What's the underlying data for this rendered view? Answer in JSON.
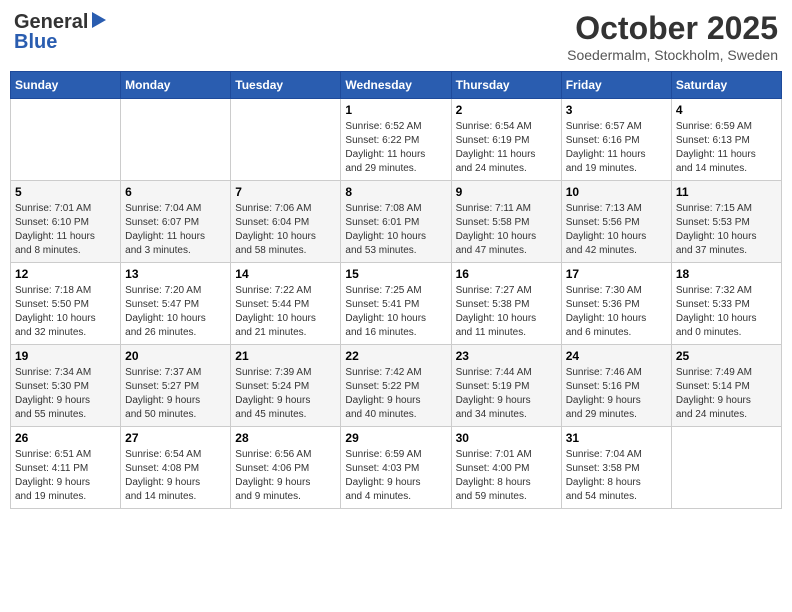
{
  "header": {
    "logo_general": "General",
    "logo_blue": "Blue",
    "month": "October 2025",
    "location": "Soedermalm, Stockholm, Sweden"
  },
  "days_of_week": [
    "Sunday",
    "Monday",
    "Tuesday",
    "Wednesday",
    "Thursday",
    "Friday",
    "Saturday"
  ],
  "weeks": [
    [
      {
        "day": "",
        "info": ""
      },
      {
        "day": "",
        "info": ""
      },
      {
        "day": "",
        "info": ""
      },
      {
        "day": "1",
        "info": "Sunrise: 6:52 AM\nSunset: 6:22 PM\nDaylight: 11 hours\nand 29 minutes."
      },
      {
        "day": "2",
        "info": "Sunrise: 6:54 AM\nSunset: 6:19 PM\nDaylight: 11 hours\nand 24 minutes."
      },
      {
        "day": "3",
        "info": "Sunrise: 6:57 AM\nSunset: 6:16 PM\nDaylight: 11 hours\nand 19 minutes."
      },
      {
        "day": "4",
        "info": "Sunrise: 6:59 AM\nSunset: 6:13 PM\nDaylight: 11 hours\nand 14 minutes."
      }
    ],
    [
      {
        "day": "5",
        "info": "Sunrise: 7:01 AM\nSunset: 6:10 PM\nDaylight: 11 hours\nand 8 minutes."
      },
      {
        "day": "6",
        "info": "Sunrise: 7:04 AM\nSunset: 6:07 PM\nDaylight: 11 hours\nand 3 minutes."
      },
      {
        "day": "7",
        "info": "Sunrise: 7:06 AM\nSunset: 6:04 PM\nDaylight: 10 hours\nand 58 minutes."
      },
      {
        "day": "8",
        "info": "Sunrise: 7:08 AM\nSunset: 6:01 PM\nDaylight: 10 hours\nand 53 minutes."
      },
      {
        "day": "9",
        "info": "Sunrise: 7:11 AM\nSunset: 5:58 PM\nDaylight: 10 hours\nand 47 minutes."
      },
      {
        "day": "10",
        "info": "Sunrise: 7:13 AM\nSunset: 5:56 PM\nDaylight: 10 hours\nand 42 minutes."
      },
      {
        "day": "11",
        "info": "Sunrise: 7:15 AM\nSunset: 5:53 PM\nDaylight: 10 hours\nand 37 minutes."
      }
    ],
    [
      {
        "day": "12",
        "info": "Sunrise: 7:18 AM\nSunset: 5:50 PM\nDaylight: 10 hours\nand 32 minutes."
      },
      {
        "day": "13",
        "info": "Sunrise: 7:20 AM\nSunset: 5:47 PM\nDaylight: 10 hours\nand 26 minutes."
      },
      {
        "day": "14",
        "info": "Sunrise: 7:22 AM\nSunset: 5:44 PM\nDaylight: 10 hours\nand 21 minutes."
      },
      {
        "day": "15",
        "info": "Sunrise: 7:25 AM\nSunset: 5:41 PM\nDaylight: 10 hours\nand 16 minutes."
      },
      {
        "day": "16",
        "info": "Sunrise: 7:27 AM\nSunset: 5:38 PM\nDaylight: 10 hours\nand 11 minutes."
      },
      {
        "day": "17",
        "info": "Sunrise: 7:30 AM\nSunset: 5:36 PM\nDaylight: 10 hours\nand 6 minutes."
      },
      {
        "day": "18",
        "info": "Sunrise: 7:32 AM\nSunset: 5:33 PM\nDaylight: 10 hours\nand 0 minutes."
      }
    ],
    [
      {
        "day": "19",
        "info": "Sunrise: 7:34 AM\nSunset: 5:30 PM\nDaylight: 9 hours\nand 55 minutes."
      },
      {
        "day": "20",
        "info": "Sunrise: 7:37 AM\nSunset: 5:27 PM\nDaylight: 9 hours\nand 50 minutes."
      },
      {
        "day": "21",
        "info": "Sunrise: 7:39 AM\nSunset: 5:24 PM\nDaylight: 9 hours\nand 45 minutes."
      },
      {
        "day": "22",
        "info": "Sunrise: 7:42 AM\nSunset: 5:22 PM\nDaylight: 9 hours\nand 40 minutes."
      },
      {
        "day": "23",
        "info": "Sunrise: 7:44 AM\nSunset: 5:19 PM\nDaylight: 9 hours\nand 34 minutes."
      },
      {
        "day": "24",
        "info": "Sunrise: 7:46 AM\nSunset: 5:16 PM\nDaylight: 9 hours\nand 29 minutes."
      },
      {
        "day": "25",
        "info": "Sunrise: 7:49 AM\nSunset: 5:14 PM\nDaylight: 9 hours\nand 24 minutes."
      }
    ],
    [
      {
        "day": "26",
        "info": "Sunrise: 6:51 AM\nSunset: 4:11 PM\nDaylight: 9 hours\nand 19 minutes."
      },
      {
        "day": "27",
        "info": "Sunrise: 6:54 AM\nSunset: 4:08 PM\nDaylight: 9 hours\nand 14 minutes."
      },
      {
        "day": "28",
        "info": "Sunrise: 6:56 AM\nSunset: 4:06 PM\nDaylight: 9 hours\nand 9 minutes."
      },
      {
        "day": "29",
        "info": "Sunrise: 6:59 AM\nSunset: 4:03 PM\nDaylight: 9 hours\nand 4 minutes."
      },
      {
        "day": "30",
        "info": "Sunrise: 7:01 AM\nSunset: 4:00 PM\nDaylight: 8 hours\nand 59 minutes."
      },
      {
        "day": "31",
        "info": "Sunrise: 7:04 AM\nSunset: 3:58 PM\nDaylight: 8 hours\nand 54 minutes."
      },
      {
        "day": "",
        "info": ""
      }
    ]
  ]
}
